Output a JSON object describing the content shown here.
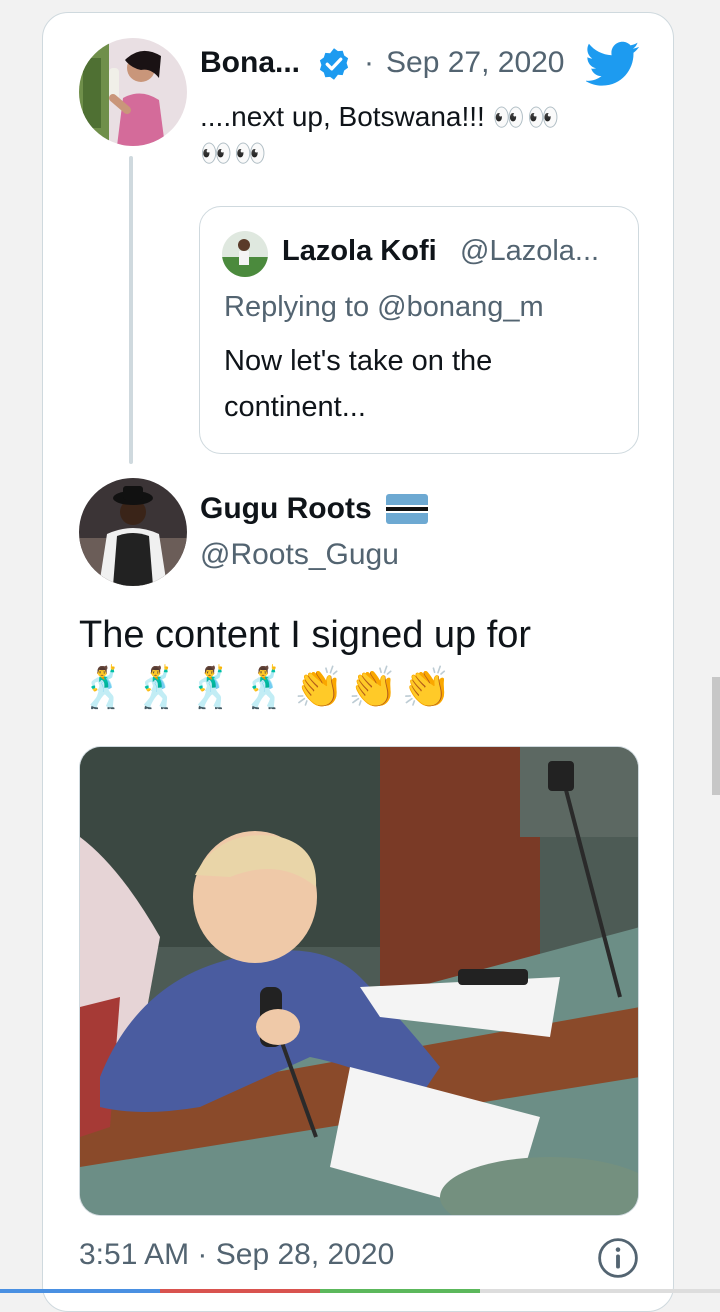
{
  "colors": {
    "twitter_blue": "#1d9bf0",
    "text_primary": "#0f1419",
    "text_secondary": "#536471",
    "border": "#cfd9de"
  },
  "parent_tweet": {
    "author_name": "Bona...",
    "verified_icon": "verified-badge-icon",
    "separator": "·",
    "date": "Sep 27, 2020",
    "text": "....next up, Botswana!!!",
    "emoji_line1": "👀👀",
    "emoji_line2": "👀👀",
    "platform_icon": "twitter-bird-icon"
  },
  "quoted_tweet": {
    "author_name": "Lazola Kofi",
    "handle": "@Lazola...",
    "replying_to_label": "Replying to",
    "replying_to_handle": "@bonang_m",
    "text_line1": "Now let's take on the",
    "text_line2": "continent..."
  },
  "main_tweet": {
    "author_name": "Gugu Roots",
    "flag_icon": "botswana-flag-icon",
    "handle": "@Roots_Gugu",
    "text": "The content I signed up for",
    "emojis": "🕺🕺🕺🕺👏👏👏",
    "image_icon": "baby-with-microphone-photo",
    "time": "3:51 AM",
    "separator": "·",
    "date": "Sep 28, 2020",
    "info_icon": "info-icon"
  }
}
